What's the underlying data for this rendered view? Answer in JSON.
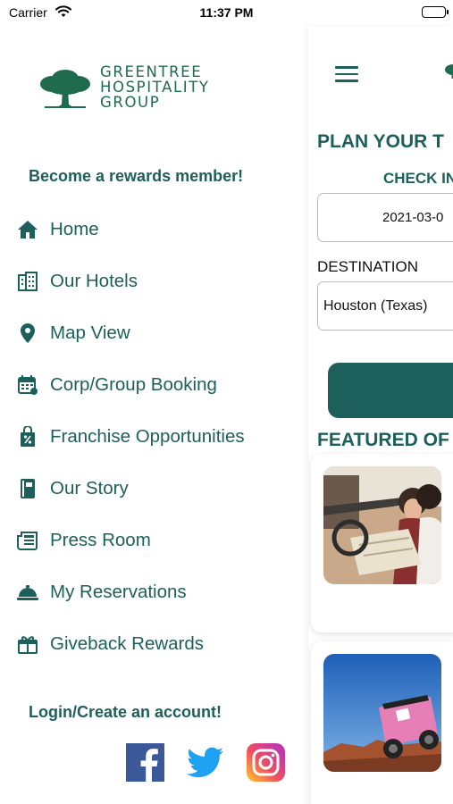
{
  "status_bar": {
    "carrier": "Carrier",
    "time": "11:37 PM"
  },
  "drawer": {
    "logo": {
      "line1": "GREENTREE",
      "line2": "HOSPITALITY",
      "line3": "GROUP"
    },
    "rewards_link": "Become a rewards member!",
    "menu_items": [
      {
        "label": "Home",
        "icon": "home-icon"
      },
      {
        "label": "Our Hotels",
        "icon": "building-icon"
      },
      {
        "label": "Map View",
        "icon": "map-pin-icon"
      },
      {
        "label": "Corp/Group Booking",
        "icon": "calendar-icon"
      },
      {
        "label": "Franchise Opportunities",
        "icon": "percent-bag-icon"
      },
      {
        "label": "Our Story",
        "icon": "book-icon"
      },
      {
        "label": "Press Room",
        "icon": "newspaper-icon"
      },
      {
        "label": "My Reservations",
        "icon": "concierge-bell-icon"
      },
      {
        "label": "Giveback Rewards",
        "icon": "gift-icon"
      }
    ],
    "login_link": "Login/Create an account!",
    "social": [
      "facebook-icon",
      "twitter-icon",
      "instagram-icon"
    ]
  },
  "main": {
    "plan_title": "PLAN YOUR T",
    "checkin_label": "CHECK IN",
    "checkin_value": "2021-03-0",
    "destination_label": "DESTINATION",
    "destination_value": "Houston (Texas)",
    "featured_title": "FEATURED OF"
  },
  "colors": {
    "brand_teal": "#1d5f5a",
    "logo_green": "#1f6b4f",
    "facebook": "#3b5998",
    "twitter": "#1da1f2"
  }
}
